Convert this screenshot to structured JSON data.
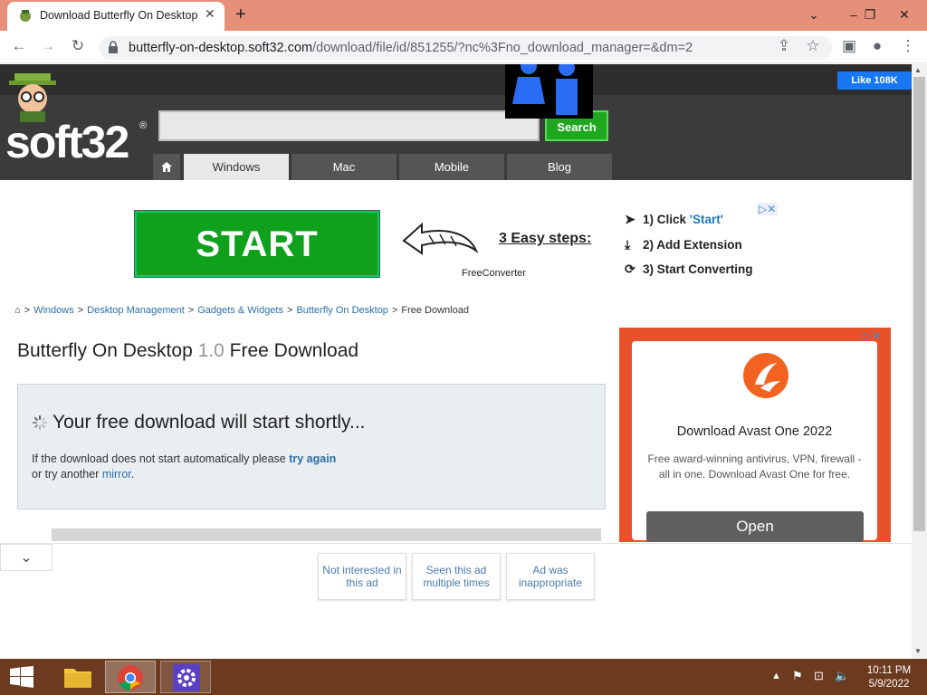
{
  "browser": {
    "tab_title": "Download Butterfly On Desktop",
    "tab_close": "✕",
    "new_tab": "+",
    "url_host": "butterfly-on-desktop.soft32.com",
    "url_path": "/download/file/id/851255/?nc%3Fno_download_manager=&dm=2",
    "window_controls": {
      "minimize": "⌄",
      "restore": "❐",
      "close": "✕"
    },
    "nav": {
      "back": "←",
      "forward": "→",
      "reload": "↻",
      "lock": "🔒",
      "share": "⇪",
      "star": "☆",
      "sidepanel": "▣",
      "profile": "●",
      "menu": "⋮"
    }
  },
  "site": {
    "logo": "soft32",
    "logo_reg": "®",
    "search_button": "Search",
    "fb_like": "Like 108K",
    "nav_tabs": [
      "Windows",
      "Mac",
      "Mobile",
      "Blog"
    ]
  },
  "ad_banner": {
    "start_label": "START",
    "steps_title": "3 Easy steps:",
    "brand": "FreeConverter",
    "step1_prefix": "1) Click ",
    "step1_quote": "'Start'",
    "step2": "2) Add Extension",
    "step3": "3) Start Converting",
    "adchoices": "▷✕"
  },
  "breadcrumb": {
    "items": [
      "Windows",
      "Desktop Management",
      "Gadgets & Widgets",
      "Butterfly On Desktop"
    ],
    "current": "Free Download",
    "separator": ">"
  },
  "heading": {
    "name": "Butterfly On Desktop",
    "version": "1.0",
    "suffix": "Free Download"
  },
  "download_box": {
    "title": "Your free download will start shortly...",
    "msg_prefix": "If the download does not start automatically please ",
    "try_again": "try again",
    "msg_mid": " or try another ",
    "mirror": "mirror",
    "msg_end": "."
  },
  "side_ad": {
    "title": "Download Avast One 2022",
    "text": "Free award-winning antivirus, VPN, firewall - all in one. Download Avast One for free.",
    "button": "Open",
    "adchoices": "▷✕"
  },
  "ad_feedback": {
    "collapse": "⌄",
    "options": [
      "Not interested in this ad",
      "Seen this ad multiple times",
      "Ad was inappropriate"
    ]
  },
  "taskbar": {
    "time": "10:11 PM",
    "date": "5/9/2022",
    "tray_up": "▲"
  },
  "colors": {
    "titlebar": "#e6907a",
    "start_green": "#0fa11c",
    "avast_orange": "#e8522b",
    "taskbar": "#6b3a1f"
  }
}
